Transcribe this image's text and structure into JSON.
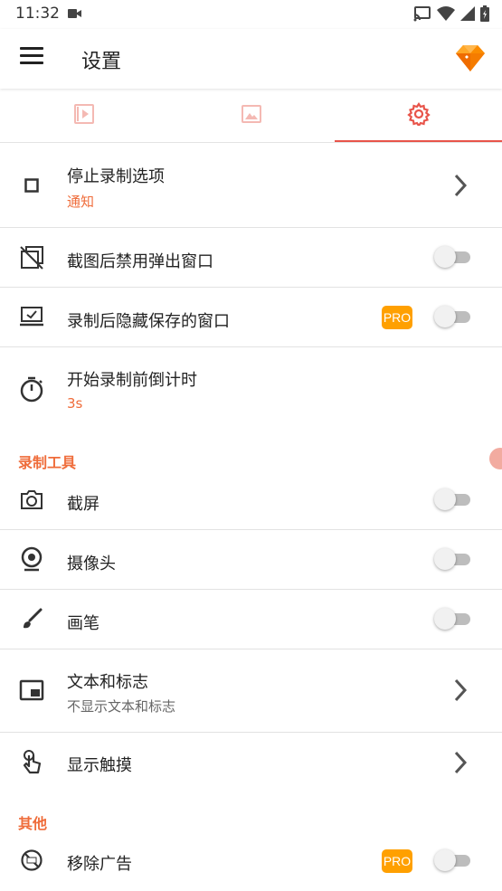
{
  "status_bar": {
    "time": "11:32",
    "icons": [
      "video-record-icon",
      "cast-icon",
      "wifi-icon",
      "signal-icon",
      "battery-icon"
    ]
  },
  "app_bar": {
    "title": "设置",
    "menu_icon": "hamburger-menu-icon",
    "premium_icon": "diamond-icon"
  },
  "tabs": [
    {
      "icon": "video-play-icon",
      "selected": false
    },
    {
      "icon": "image-icon",
      "selected": false
    },
    {
      "icon": "gear-icon",
      "selected": true
    }
  ],
  "colors": {
    "accent": "#ef6c3a",
    "tab_active": "#e8544a",
    "tab_inactive": "#f4b9b3",
    "pro_badge": "#ffa000"
  },
  "settings": {
    "stop_recording": {
      "label": "停止录制选项",
      "value": "通知"
    },
    "disable_popup": {
      "label": "截图后禁用弹出窗口",
      "enabled": false
    },
    "hide_saved_window": {
      "label": "录制后隐藏保存的窗口",
      "badge": "PRO",
      "enabled": false
    },
    "countdown": {
      "label": "开始录制前倒计时",
      "value": "3s"
    }
  },
  "recording_tools": {
    "header": "录制工具",
    "screenshot": {
      "label": "截屏",
      "enabled": false
    },
    "camera": {
      "label": "摄像头",
      "enabled": false
    },
    "brush": {
      "label": "画笔",
      "enabled": false
    },
    "text_logo": {
      "label": "文本和标志",
      "value": "不显示文本和标志"
    },
    "show_touches": {
      "label": "显示触摸"
    }
  },
  "other": {
    "header": "其他",
    "remove_ads": {
      "label": "移除广告",
      "badge": "PRO",
      "enabled": false
    }
  }
}
